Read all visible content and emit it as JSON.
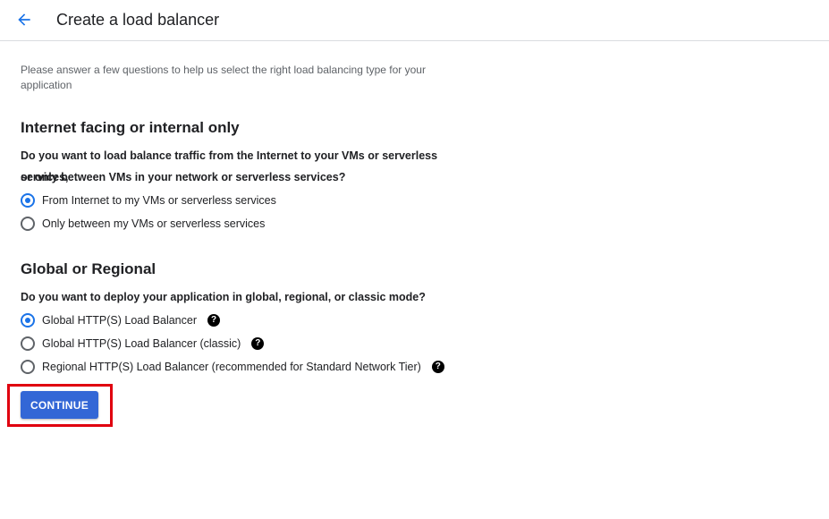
{
  "header": {
    "title": "Create a load balancer"
  },
  "intro": "Please answer a few questions to help us select the right load balancing type for your application",
  "sections": [
    {
      "title": "Internet facing or internal only",
      "question_line1": "Do you want to load balance traffic from the Internet to your VMs or serverless services,",
      "question_line2": "or only between VMs in your network or serverless services?",
      "options": [
        {
          "label": "From Internet to my VMs or serverless services",
          "selected": true
        },
        {
          "label": "Only between my VMs or serverless services",
          "selected": false
        }
      ]
    },
    {
      "title": "Global or Regional",
      "question_line1": "Do you want to deploy your application in global, regional, or classic mode?",
      "options": [
        {
          "label": "Global HTTP(S) Load Balancer",
          "selected": true,
          "help_icon": "?"
        },
        {
          "label": "Global HTTP(S) Load Balancer (classic)",
          "selected": false,
          "help_icon": "?"
        },
        {
          "label": "Regional HTTP(S) Load Balancer (recommended for Standard Network Tier)",
          "selected": false,
          "help_icon": "?"
        }
      ]
    }
  ],
  "continue_button": "CONTINUE",
  "colors": {
    "accent": "#1a73e8",
    "button": "#3367d6",
    "highlight": "#e0000f"
  },
  "icons": {
    "back": "arrow-back-icon",
    "help": "help-circle-icon"
  }
}
